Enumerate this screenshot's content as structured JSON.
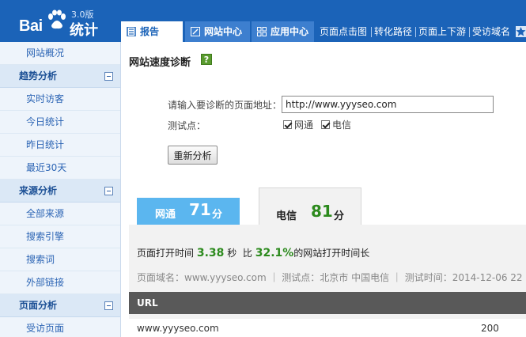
{
  "logo": {
    "brand": "Bai",
    "product": "统计",
    "version": "3.0版"
  },
  "header": {
    "tabs": [
      {
        "label": "报告",
        "icon": "report-icon"
      },
      {
        "label": "网站中心",
        "icon": "edit-icon"
      },
      {
        "label": "应用中心",
        "icon": "grid-icon"
      }
    ],
    "links": [
      "页面点击图",
      "转化路径",
      "页面上下游",
      "受访域名"
    ]
  },
  "sidebar": {
    "items": [
      {
        "type": "item",
        "label": "网站概况"
      },
      {
        "type": "head",
        "label": "趋势分析"
      },
      {
        "type": "item",
        "label": "实时访客"
      },
      {
        "type": "item",
        "label": "今日统计"
      },
      {
        "type": "item",
        "label": "昨日统计"
      },
      {
        "type": "item",
        "label": "最近30天"
      },
      {
        "type": "head",
        "label": "来源分析"
      },
      {
        "type": "item",
        "label": "全部来源"
      },
      {
        "type": "item",
        "label": "搜索引擎"
      },
      {
        "type": "item",
        "label": "搜索词"
      },
      {
        "type": "item",
        "label": "外部链接"
      },
      {
        "type": "head",
        "label": "页面分析"
      },
      {
        "type": "item",
        "label": "受访页面"
      }
    ]
  },
  "main": {
    "title": "网站速度诊断",
    "help": "?",
    "form": {
      "url_label": "请输入要诊断的页面地址：",
      "url_value": "http://www.yyyseo.com",
      "test_label": "测试点：",
      "test_points": [
        "网通",
        "电信"
      ],
      "reanalyze": "重新分析"
    },
    "results": {
      "tabs": [
        {
          "name": "网通",
          "score": "71",
          "unit": "分"
        },
        {
          "name": "电信",
          "score": "81",
          "unit": "分"
        }
      ],
      "summary": {
        "prefix": "页面打开时间",
        "time": "3.38",
        "time_unit": "秒",
        "compare_prefix": "比",
        "percent": "32.1%",
        "suffix": "的网站打开时间长"
      },
      "meta": "页面域名：www.yyyseo.com ｜ 测试点：北京市  中国电信 ｜ 测试时间：2014-12-06 22",
      "table": {
        "header": "URL",
        "rows": [
          {
            "url": "www.yyyseo.com",
            "code": "200"
          }
        ]
      }
    }
  },
  "colors": {
    "header_blue": "#1b63b8",
    "score_green": "#2c8a1d",
    "wangtong_blue": "#5bb6ef"
  }
}
